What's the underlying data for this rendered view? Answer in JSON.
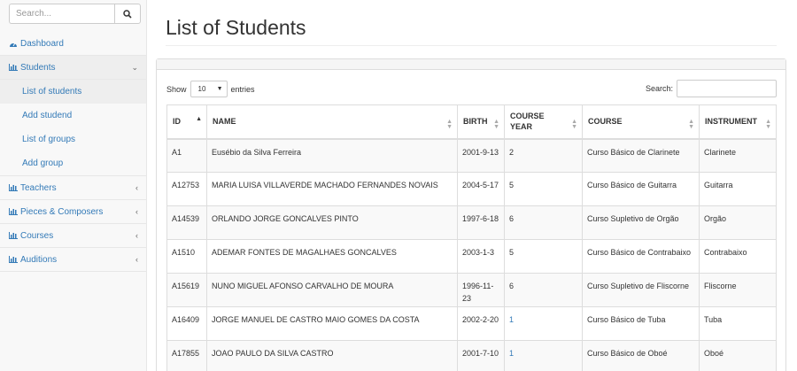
{
  "sidebar": {
    "search_placeholder": "Search...",
    "items": [
      {
        "label": "Dashboard",
        "icon": "dashboard-icon"
      },
      {
        "label": "Students",
        "icon": "bar-chart-icon",
        "expanded": true,
        "children": [
          {
            "label": "List of students",
            "active": true
          },
          {
            "label": "Add studend"
          },
          {
            "label": "List of groups"
          },
          {
            "label": "Add group"
          }
        ]
      },
      {
        "label": "Teachers",
        "icon": "bar-chart-icon"
      },
      {
        "label": "Pieces & Composers",
        "icon": "bar-chart-icon"
      },
      {
        "label": "Courses",
        "icon": "bar-chart-icon"
      },
      {
        "label": "Auditions",
        "icon": "bar-chart-icon"
      }
    ]
  },
  "main": {
    "title": "List of Students",
    "show_label": "Show",
    "page_length": "10",
    "entries_label": "entries",
    "search_label": "Search:",
    "columns": [
      "ID",
      "NAME",
      "BIRTH",
      "COURSE YEAR",
      "COURSE",
      "INSTRUMENT"
    ],
    "rows": [
      {
        "id": "A1",
        "name": "Eusébio da Silva Ferreira",
        "birth": "2001-9-13",
        "year": "2",
        "course": "Curso Básico de Clarinete",
        "instrument": "Clarinete"
      },
      {
        "id": "A12753",
        "name": "MARIA LUISA VILLAVERDE MACHADO FERNANDES NOVAIS",
        "birth": "2004-5-17",
        "year": "5",
        "course": "Curso Básico de Guitarra",
        "instrument": "Guitarra"
      },
      {
        "id": "A14539",
        "name": "ORLANDO JORGE GONCALVES PINTO",
        "birth": "1997-6-18",
        "year": "6",
        "course": "Curso Supletivo de Orgão",
        "instrument": "Orgão"
      },
      {
        "id": "A1510",
        "name": "ADEMAR FONTES DE MAGALHAES GONCALVES",
        "birth": "2003-1-3",
        "year": "5",
        "course": "Curso Básico de Contrabaixo",
        "instrument": "Contrabaixo"
      },
      {
        "id": "A15619",
        "name": "NUNO MIGUEL AFONSO CARVALHO DE MOURA",
        "birth": "1996-11-23",
        "year": "6",
        "course": "Curso Supletivo de Fliscorne",
        "instrument": "Fliscorne"
      },
      {
        "id": "A16409",
        "name": "JORGE MANUEL DE CASTRO MAIO GOMES DA COSTA",
        "birth": "2002-2-20",
        "year": "1",
        "course": "Curso Básico de Tuba",
        "instrument": "Tuba"
      },
      {
        "id": "A17855",
        "name": "JOAO PAULO DA SILVA CASTRO",
        "birth": "2001-7-10",
        "year": "1",
        "course": "Curso Básico de Oboé",
        "instrument": "Oboé"
      }
    ]
  }
}
